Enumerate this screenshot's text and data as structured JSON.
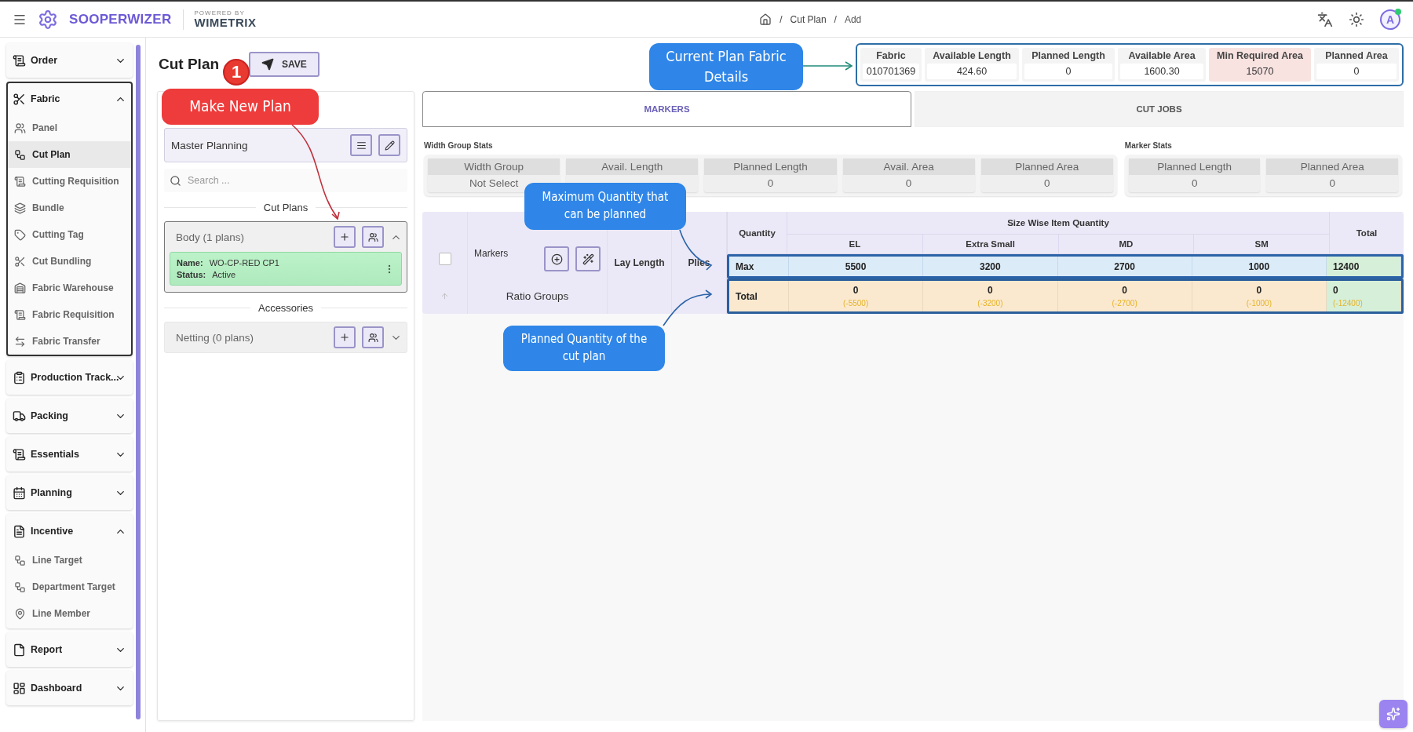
{
  "header": {
    "brand": "SOOPERWIZER",
    "powered_by": "POWERED BY",
    "partner": "WIMETRIX",
    "breadcrumb": [
      {
        "kind": "separator",
        "text": "/"
      },
      {
        "kind": "link",
        "text": "Cut Plan"
      },
      {
        "kind": "separator",
        "text": "/"
      },
      {
        "kind": "current",
        "text": "Add"
      }
    ],
    "avatar": "A",
    "online": true
  },
  "sidebar": {
    "groups": [
      {
        "label": "Order",
        "expanded": false,
        "active": false
      },
      {
        "label": "Fabric",
        "expanded": true,
        "active": true,
        "children": [
          {
            "label": "Panel",
            "selected": false
          },
          {
            "label": "Cut Plan",
            "selected": true
          },
          {
            "label": "Cutting Requisition",
            "selected": false
          },
          {
            "label": "Bundle",
            "selected": false
          },
          {
            "label": "Cutting Tag",
            "selected": false
          },
          {
            "label": "Cut Bundling",
            "selected": false
          },
          {
            "label": "Fabric Warehouse",
            "selected": false
          },
          {
            "label": "Fabric Requisition",
            "selected": false
          },
          {
            "label": "Fabric Transfer",
            "selected": false
          }
        ]
      },
      {
        "label": "Production Track...",
        "expanded": false,
        "active": false
      },
      {
        "label": "Packing",
        "expanded": false,
        "active": false
      },
      {
        "label": "Essentials",
        "expanded": false,
        "active": false
      },
      {
        "label": "Planning",
        "expanded": false,
        "active": false
      },
      {
        "label": "Incentive",
        "expanded": true,
        "active": false,
        "children": [
          {
            "label": "Line Target",
            "selected": false
          },
          {
            "label": "Department Target",
            "selected": false
          },
          {
            "label": "Line Member",
            "selected": false
          }
        ]
      },
      {
        "label": "Report",
        "expanded": false,
        "active": false
      },
      {
        "label": "Dashboard",
        "expanded": false,
        "active": false
      }
    ]
  },
  "page": {
    "title": "Cut Plan",
    "step_badge": "1",
    "save_button": "SAVE"
  },
  "fabric_details": [
    {
      "label": "Fabric",
      "value": "010701369",
      "highlight": false
    },
    {
      "label": "Available Length",
      "value": "424.60",
      "highlight": false
    },
    {
      "label": "Planned Length",
      "value": "0",
      "highlight": false
    },
    {
      "label": "Available Area",
      "value": "1600.30",
      "highlight": false
    },
    {
      "label": "Min Required Area",
      "value": "15070",
      "highlight": true
    },
    {
      "label": "Planned Area",
      "value": "0",
      "highlight": false
    }
  ],
  "left_panel": {
    "master_planning": "Master Planning",
    "search": {
      "placeholder": "Search ..."
    },
    "sections": [
      {
        "title": "Cut Plans",
        "groups": [
          {
            "label": "Body (1 plans)",
            "expanded": true,
            "plans": [
              {
                "name_label": "Name:",
                "name": "WO-CP-RED CP1",
                "status_label": "Status:",
                "status": "Active"
              }
            ]
          }
        ]
      },
      {
        "title": "Accessories",
        "groups": [
          {
            "label": "Netting (0 plans)",
            "expanded": false
          }
        ]
      }
    ]
  },
  "tabs": [
    {
      "label": "MARKERS",
      "selected": true
    },
    {
      "label": "CUT JOBS",
      "selected": false
    }
  ],
  "width_group_stats": {
    "title": "Width Group Stats",
    "cells": [
      {
        "label": "Width Group",
        "value": "Not Select"
      },
      {
        "label": "Avail. Length"
      },
      {
        "label": "Planned Length",
        "value": "0"
      },
      {
        "label": "Avail. Area",
        "value": "0"
      },
      {
        "label": "Planned Area",
        "value": "0"
      }
    ]
  },
  "marker_stats": {
    "title": "Marker Stats",
    "cells": [
      {
        "label": "Planned Length",
        "value": "0"
      },
      {
        "label": "Planned Area",
        "value": "0"
      }
    ]
  },
  "table": {
    "checked": false,
    "markers": "Markers",
    "ratio_groups": "Ratio Groups",
    "lay_length": "Lay Length",
    "plies": "Plies",
    "quantity": "Quantity",
    "size_group": "Size Wise Item Quantity",
    "total": "Total",
    "sizes": [
      "EL",
      "Extra Small",
      "MD",
      "SM"
    ],
    "rows": [
      {
        "kind": "max",
        "label": "Max",
        "values": [
          {
            "value": "5500"
          },
          {
            "value": "3200"
          },
          {
            "value": "2700"
          },
          {
            "value": "1000"
          }
        ],
        "total": {
          "value": "12400"
        }
      },
      {
        "kind": "total",
        "label": "Total",
        "values": [
          {
            "value": "0",
            "diff": "(-5500)"
          },
          {
            "value": "0",
            "diff": "(-3200)"
          },
          {
            "value": "0",
            "diff": "(-2700)"
          },
          {
            "value": "0",
            "diff": "(-1000)"
          }
        ],
        "total": {
          "value": "0",
          "diff": "(-12400)"
        }
      }
    ]
  },
  "callouts": [
    {
      "text": "Current Plan Fabric Details",
      "color": "#2f86e8"
    },
    {
      "text": "Make New Plan",
      "color": "#ee3b3b"
    },
    {
      "text": "Maximum Quantity that can be planned",
      "color": "#2f86e8"
    },
    {
      "text": "Planned Quantity of the cut plan",
      "color": "#2f86e8"
    }
  ]
}
